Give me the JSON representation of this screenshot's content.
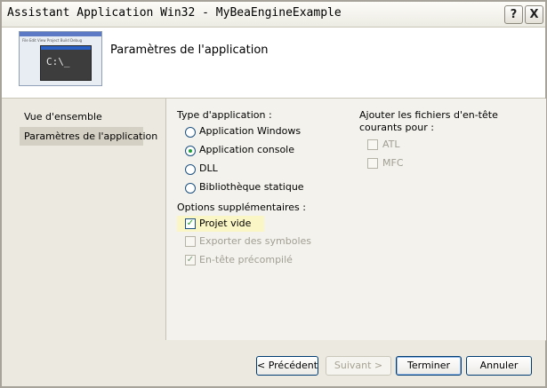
{
  "window": {
    "title": "Assistant Application Win32 - MyBeaEngineExample",
    "help_glyph": "?",
    "close_glyph": "X"
  },
  "header": {
    "title": "Paramètres de l'application",
    "thumb_menu": "File Edit View Project Build Debug",
    "console_prompt": "C:\\_"
  },
  "nav": {
    "items": [
      {
        "label": "Vue d'ensemble",
        "selected": false
      },
      {
        "label": "Paramètres de l'application",
        "selected": true
      }
    ]
  },
  "app_type": {
    "heading": "Type d'application :",
    "options": [
      {
        "label": "Application Windows",
        "selected": false
      },
      {
        "label": "Application console",
        "selected": true
      },
      {
        "label": "DLL",
        "selected": false
      },
      {
        "label": "Bibliothèque statique",
        "selected": false
      }
    ]
  },
  "extra_options": {
    "heading": "Options supplémentaires :",
    "items": [
      {
        "label": "Projet vide",
        "checked": true,
        "enabled": true
      },
      {
        "label": "Exporter des symboles",
        "checked": false,
        "enabled": false
      },
      {
        "label": "En-tête précompilé",
        "checked": true,
        "enabled": false
      }
    ]
  },
  "headers_group": {
    "heading": "Ajouter les fichiers d'en-tête courants pour :",
    "items": [
      {
        "label": "ATL",
        "checked": false,
        "enabled": false
      },
      {
        "label": "MFC",
        "checked": false,
        "enabled": false
      }
    ]
  },
  "buttons": {
    "previous": "< Précédent",
    "next": "Suivant >",
    "finish": "Terminer",
    "cancel": "Annuler"
  },
  "colors": {
    "accent_radio": "#23a03c",
    "highlight": "#fbf6c6",
    "selected_nav": "#d4d0c3"
  }
}
